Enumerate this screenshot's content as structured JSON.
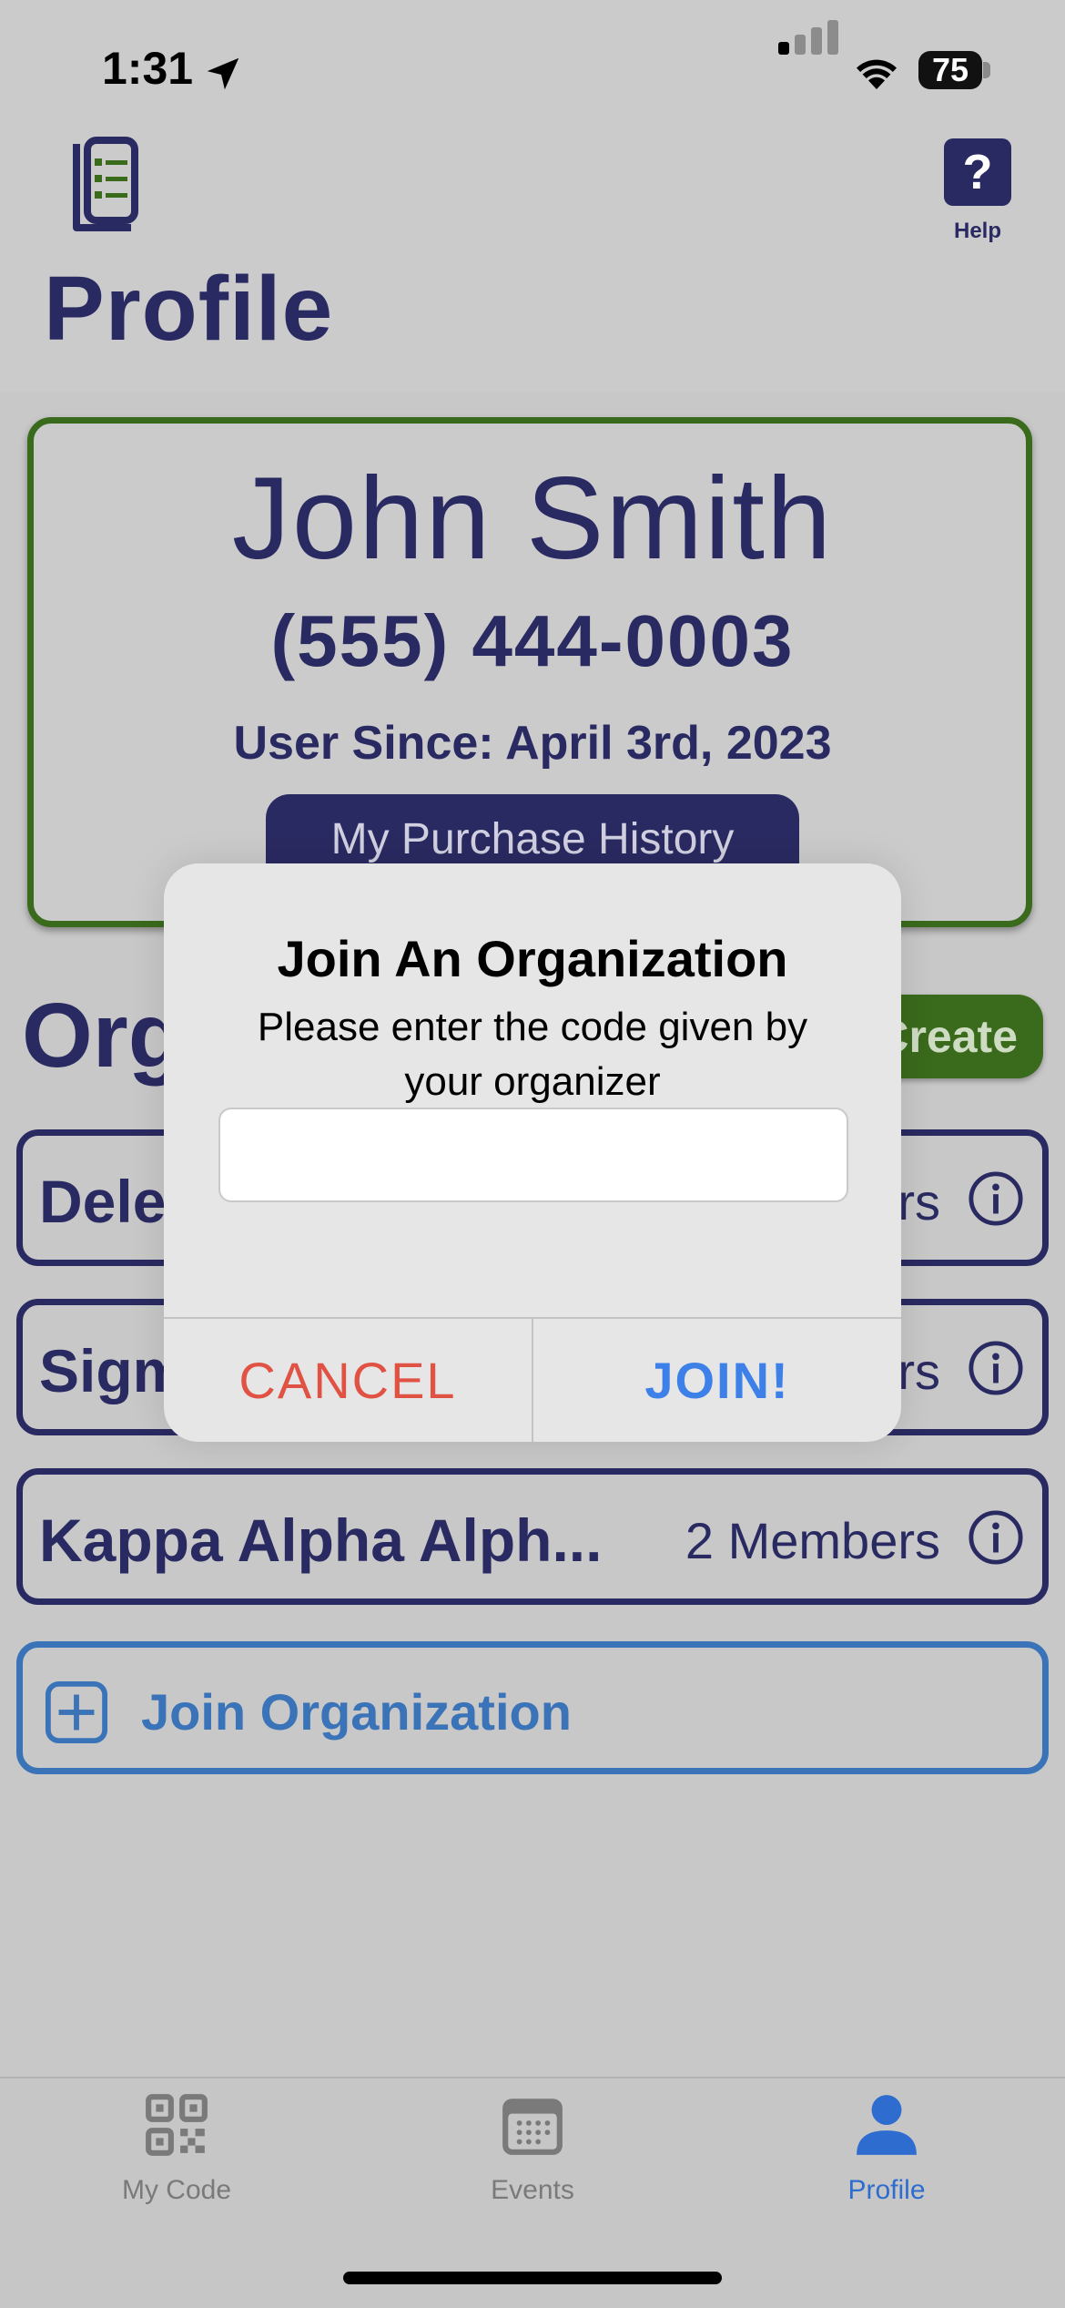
{
  "status_bar": {
    "time": "1:31",
    "battery": "75"
  },
  "header": {
    "title": "Profile",
    "help_label": "Help",
    "help_glyph": "?"
  },
  "profile": {
    "name": "John Smith",
    "phone": "(555) 444-0003",
    "user_since": "User Since: April 3rd, 2023",
    "purchase_history_label": "My Purchase History"
  },
  "organizations": {
    "title": "Organizations",
    "create_label": "Create Org",
    "rows": [
      {
        "name": "Delegates",
        "members": "3 Members"
      },
      {
        "name": "Sigma Chi",
        "members": "5 Members"
      },
      {
        "name": "Kappa Alpha Alph...",
        "members": "2 Members"
      }
    ],
    "join_label": "Join Organization"
  },
  "alert": {
    "title": "Join An Organization",
    "message": "Please enter the code given by your organizer",
    "input_value": "",
    "cancel_label": "CANCEL",
    "join_label": "JOIN!"
  },
  "tabs": [
    {
      "label": "My Code",
      "icon": "qr-code-icon",
      "active": false
    },
    {
      "label": "Events",
      "icon": "calendar-icon",
      "active": false
    },
    {
      "label": "Profile",
      "icon": "person-icon",
      "active": true
    }
  ],
  "colors": {
    "navy": "#2a2a62",
    "green": "#3a6a1c",
    "blue": "#3b73b8",
    "cancel": "#e05244",
    "join": "#3c80e8"
  }
}
